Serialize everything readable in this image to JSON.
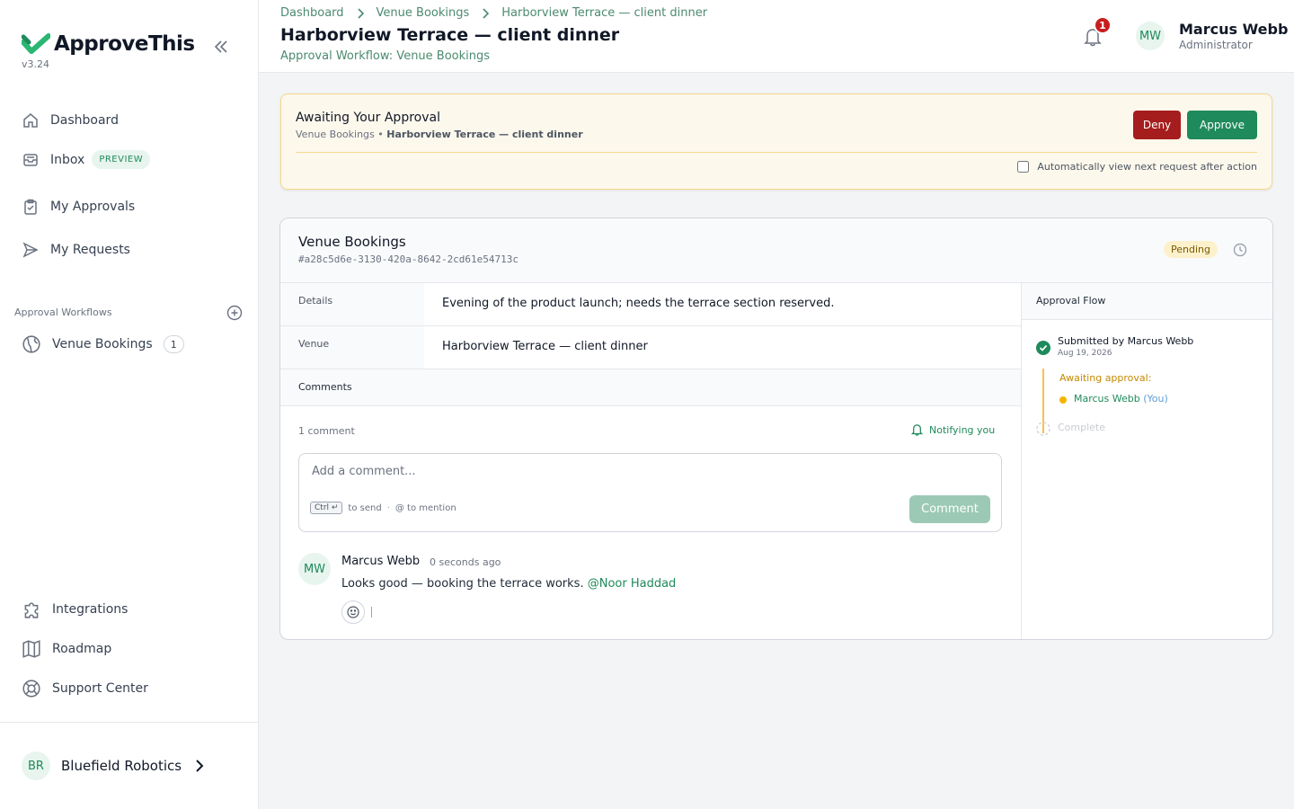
{
  "app": {
    "name": "ApproveThis",
    "version": "v3.24",
    "brand_color": "#1f8a5b"
  },
  "sidebar": {
    "nav": [
      {
        "label": "Dashboard",
        "icon": "home-icon"
      },
      {
        "label": "Inbox",
        "icon": "inbox-icon",
        "badge": "PREVIEW"
      },
      {
        "label": "My Approvals",
        "icon": "clipboard-check-icon"
      },
      {
        "label": "My Requests",
        "icon": "send-icon"
      }
    ],
    "section_label": "Approval Workflows",
    "workflows": [
      {
        "label": "Venue Bookings",
        "icon": "globe-icon",
        "count": "1"
      }
    ],
    "bottom": [
      {
        "label": "Integrations",
        "icon": "puzzle-icon"
      },
      {
        "label": "Roadmap",
        "icon": "map-icon"
      },
      {
        "label": "Support Center",
        "icon": "lifebuoy-icon"
      }
    ],
    "org": {
      "initials": "BR",
      "name": "Bluefield Robotics"
    }
  },
  "header": {
    "breadcrumbs": [
      "Dashboard",
      "Venue Bookings",
      "Harborview Terrace — client dinner"
    ],
    "title": "Harborview Terrace — client dinner",
    "subtitle": "Approval Workflow: Venue Bookings",
    "notifications": "1",
    "user": {
      "initials": "MW",
      "name": "Marcus Webb",
      "role": "Administrator"
    }
  },
  "awaiting": {
    "title": "Awaiting Your Approval",
    "workflow": "Venue Bookings",
    "request": "Harborview Terrace — client dinner",
    "deny_label": "Deny",
    "approve_label": "Approve",
    "auto_next_label": "Automatically view next request after action",
    "auto_next_checked": false
  },
  "request": {
    "workflow": "Venue Bookings",
    "id": "#a28c5d6e-3130-420a-8642-2cd61e54713c",
    "status": "Pending",
    "fields": [
      {
        "label": "Details",
        "value": "Evening of the product launch; needs the terrace section reserved."
      },
      {
        "label": "Venue",
        "value": "Harborview Terrace — client dinner"
      }
    ]
  },
  "comments": {
    "header": "Comments",
    "count_label": "1 comment",
    "notify_label": "Notifying you",
    "placeholder": "Add a comment...",
    "hint_key": "Ctrl ↵",
    "hint_send": "to send",
    "hint_mention": "@ to mention",
    "submit_label": "Comment",
    "items": [
      {
        "initials": "MW",
        "author": "Marcus Webb",
        "time": "0 seconds ago",
        "text": "Looks good — booking the terrace works.",
        "mention": "@Noor Haddad"
      }
    ]
  },
  "flow": {
    "header": "Approval Flow",
    "submitted": "Submitted by Marcus Webb",
    "submitted_date": "Aug 19, 2026",
    "awaiting_label": "Awaiting approval:",
    "approver": "Marcus Webb",
    "approver_tag": "(You)",
    "complete_label": "Complete"
  }
}
